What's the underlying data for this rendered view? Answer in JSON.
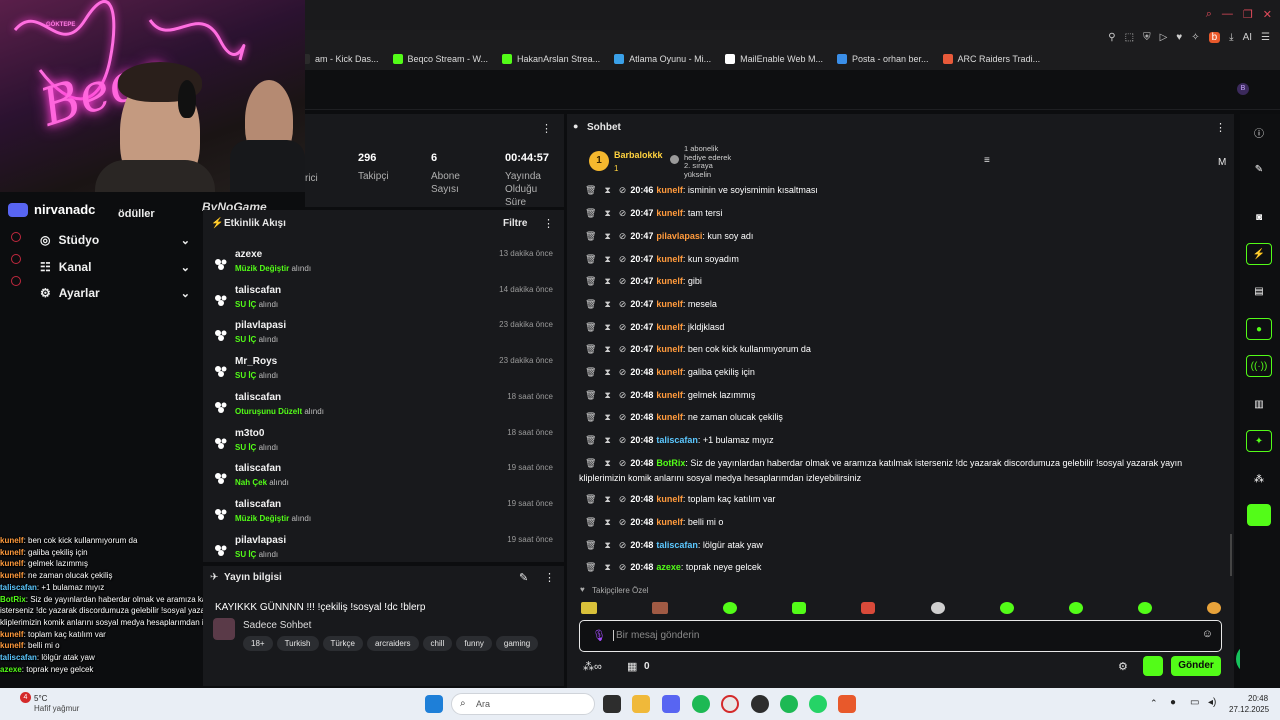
{
  "browser": {
    "bookmarks": [
      {
        "label": "am - Kick Das...",
        "color": "#2b2b2b"
      },
      {
        "label": "Beqco Stream - W...",
        "color": "#53fc18"
      },
      {
        "label": "HakanArslan Strea...",
        "color": "#53fc18"
      },
      {
        "label": "Atlama Oyunu - Mi...",
        "color": "#3aa0e8"
      },
      {
        "label": "MailEnable Web M...",
        "color": "#ffffff"
      },
      {
        "label": "Posta - orhan ber...",
        "color": "#3a8ee8"
      },
      {
        "label": "ARC Raiders Tradi...",
        "color": "#e85a3a"
      }
    ],
    "ai_label": "AI"
  },
  "webcam": {
    "neon_text": "Beco",
    "sign_text": "GÖKTEPE"
  },
  "sidebar": {
    "channel_name": "nirvanadc",
    "rewards_label": "ödüller",
    "watermark": "ByNoGame",
    "items": [
      {
        "label": "Stüdyo",
        "icon": "studio-icon"
      },
      {
        "label": "Kanal",
        "icon": "channel-icon"
      },
      {
        "label": "Ayarlar",
        "icon": "settings-icon"
      }
    ]
  },
  "stats": {
    "partial_label": "rici",
    "items": [
      {
        "value": "296",
        "label": "Takipçi"
      },
      {
        "value": "6",
        "label": "Abone Sayısı"
      },
      {
        "value": "00:44:57",
        "label": "Yayında Olduğu Süre"
      }
    ]
  },
  "activity": {
    "title": "Etkinlik Akışı",
    "filter_label": "Filtre",
    "received_word": "alındı",
    "items": [
      {
        "user": "azexe",
        "reward": "Müzik Değiştir",
        "time": "13 dakika önce"
      },
      {
        "user": "taliscafan",
        "reward": "SU İÇ",
        "time": "14 dakika önce"
      },
      {
        "user": "pilavlapasi",
        "reward": "SU İÇ",
        "time": "23 dakika önce"
      },
      {
        "user": "Mr_Roys",
        "reward": "SU İÇ",
        "time": "23 dakika önce"
      },
      {
        "user": "taliscafan",
        "reward": "Oturuşunu Düzelt",
        "time": "18 saat önce"
      },
      {
        "user": "m3to0",
        "reward": "SU İÇ",
        "time": "18 saat önce"
      },
      {
        "user": "taliscafan",
        "reward": "Nah Çek",
        "time": "19 saat önce"
      },
      {
        "user": "taliscafan",
        "reward": "Müzik Değiştir",
        "time": "19 saat önce"
      },
      {
        "user": "pilavlapasi",
        "reward": "SU İÇ",
        "time": "19 saat önce"
      }
    ]
  },
  "stream_info": {
    "title": "Yayın bilgisi",
    "stream_title": "KAYIKKK GÜNNNN !!! !çekiliş !sosyal !dc !blerp",
    "chat_mode": "Sadece Sohbet",
    "tags": [
      "18+",
      "Turkish",
      "Türkçe",
      "arcraiders",
      "chill",
      "funny",
      "gaming"
    ]
  },
  "chat": {
    "title": "Sohbet",
    "pinned": {
      "rank": "1",
      "user": "Barbalokkk",
      "count": "1",
      "note_lines": [
        "1 abonelik",
        "hediye ederek",
        "2. sıraya",
        "yükselin"
      ]
    },
    "m_label": "M",
    "followers_only": "Takipçilere Özel",
    "input_placeholder": "Bir mesaj gönderin",
    "send_label": "Gönder",
    "points": "0",
    "messages": [
      {
        "time": "20:46",
        "user": "kunelf",
        "cls": "un-orange",
        "text": "isminin ve soyismimin kısaltması"
      },
      {
        "time": "20:47",
        "user": "kunelf",
        "cls": "un-orange",
        "text": "tam tersi"
      },
      {
        "time": "20:47",
        "user": "pilavlapasi",
        "cls": "un-orange",
        "text": "kun soy adı"
      },
      {
        "time": "20:47",
        "user": "kunelf",
        "cls": "un-orange",
        "text": "kun soyadım"
      },
      {
        "time": "20:47",
        "user": "kunelf",
        "cls": "un-orange",
        "text": "gibi"
      },
      {
        "time": "20:47",
        "user": "kunelf",
        "cls": "un-orange",
        "text": "mesela"
      },
      {
        "time": "20:47",
        "user": "kunelf",
        "cls": "un-orange",
        "text": "jkldjklasd"
      },
      {
        "time": "20:47",
        "user": "kunelf",
        "cls": "un-orange",
        "text": "ben cok kick kullanmıyorum da"
      },
      {
        "time": "20:48",
        "user": "kunelf",
        "cls": "un-orange",
        "text": "galiba çekiliş için"
      },
      {
        "time": "20:48",
        "user": "kunelf",
        "cls": "un-orange",
        "text": "gelmek lazımmış"
      },
      {
        "time": "20:48",
        "user": "kunelf",
        "cls": "un-orange",
        "text": "ne zaman olucak çekiliş"
      },
      {
        "time": "20:48",
        "user": "taliscafan",
        "cls": "un-cyan",
        "text": "+1 bulamaz mıyız"
      },
      {
        "time": "20:48",
        "user": "BotRix",
        "cls": "un-green",
        "text": "Siz de yayınlardan haberdar olmak ve aramıza katılmak isterseniz !dc yazarak discordumuza gelebilir !sosyal yazarak yayın",
        "text2": "kliplerimizin komik anlarını sosyal medya hesaplarımdan izleyebilirsiniz"
      },
      {
        "time": "20:48",
        "user": "kunelf",
        "cls": "un-orange",
        "text": "toplam kaç katılım var"
      },
      {
        "time": "20:48",
        "user": "kunelf",
        "cls": "un-orange",
        "text": "belli mi o"
      },
      {
        "time": "20:48",
        "user": "taliscafan",
        "cls": "un-cyan",
        "text": "lölgür atak yaw"
      },
      {
        "time": "20:48",
        "user": "azexe",
        "cls": "un-green",
        "text": "toprak neye gelcek"
      }
    ]
  },
  "overlay_chat": [
    {
      "user": "kunelf",
      "text": "ben cok kick kullanmıyorum da"
    },
    {
      "user": "kunelf",
      "text": "galiba çekiliş için"
    },
    {
      "user": "kunelf",
      "text": "gelmek lazımmış"
    },
    {
      "user": "kunelf",
      "text": "ne zaman olucak çekiliş"
    },
    {
      "user": "taliscafan",
      "text": "+1 bulamaz mıyız"
    },
    {
      "user": "BotRix",
      "text": "Siz de yayınlardan haberdar olmak ve aramıza katılmak isterseniz !dc yazarak discordumuza gelebilir !sosyal yazarak yayın kliplerimizin komik anlarını sosyal medya hesaplarımdan izleyebilirsiniz"
    },
    {
      "user": "kunelf",
      "text": "toplam kaç katılım var"
    },
    {
      "user": "kunelf",
      "text": "belli mi o"
    },
    {
      "user": "taliscafan",
      "text": "lölgür atak yaw"
    },
    {
      "user": "azexe",
      "text": "toprak neye gelcek"
    }
  ],
  "taskbar": {
    "weather_badge": "4",
    "temp": "5°C",
    "weather": "Hafif yağmur",
    "search_label": "Ara",
    "time": "20:48",
    "date": "27.12.2025"
  }
}
